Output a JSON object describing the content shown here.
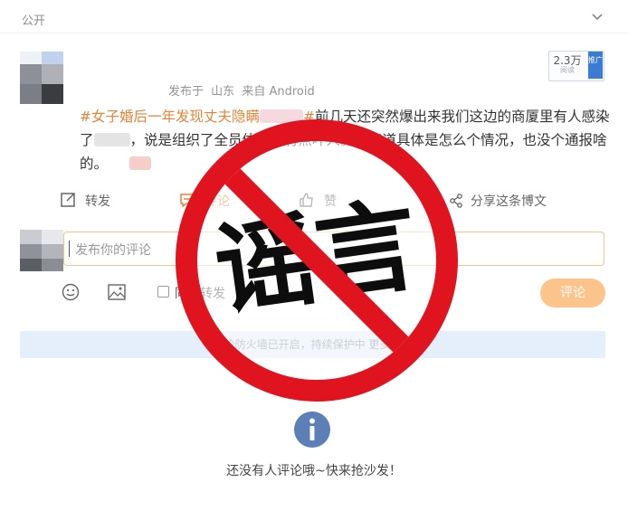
{
  "header": {
    "visibility": "公开",
    "collapse_icon": "chevron-down-icon"
  },
  "post": {
    "meta": {
      "prefix": "发布于",
      "location": "山东",
      "source": "来自 Android"
    },
    "views": {
      "count": "2.3万",
      "label": "阅读"
    },
    "promo_label": "推广",
    "hashtag": "#女子婚后一年发现丈夫隐瞒",
    "hashtag_end": "#",
    "text_1": "前几天还突然爆出来我们这边的商厦里有人感染了",
    "text_2": "，说是组织了全员体检。有点吓人。不知道具体是怎么个情况，也没个通报啥的。"
  },
  "actions": {
    "repost": "转发",
    "comment": "评论",
    "like": "赞",
    "share": "分享这条博文"
  },
  "comment_box": {
    "placeholder": "发布你的评论",
    "also_repost": "同时转发",
    "submit": "评论"
  },
  "firewall_notice": "评论防火墙已开启，持续保护中 更多设置",
  "empty_state": {
    "text": "还没有人评论哦~快来抢沙发！",
    "icon": "info-icon"
  },
  "stamp": {
    "text": "谣言",
    "color": "#e0141e"
  },
  "colors": {
    "hashtag": "#e88338",
    "accent_blue": "#3b7bd4",
    "submit_bg": "#fcc48a"
  }
}
